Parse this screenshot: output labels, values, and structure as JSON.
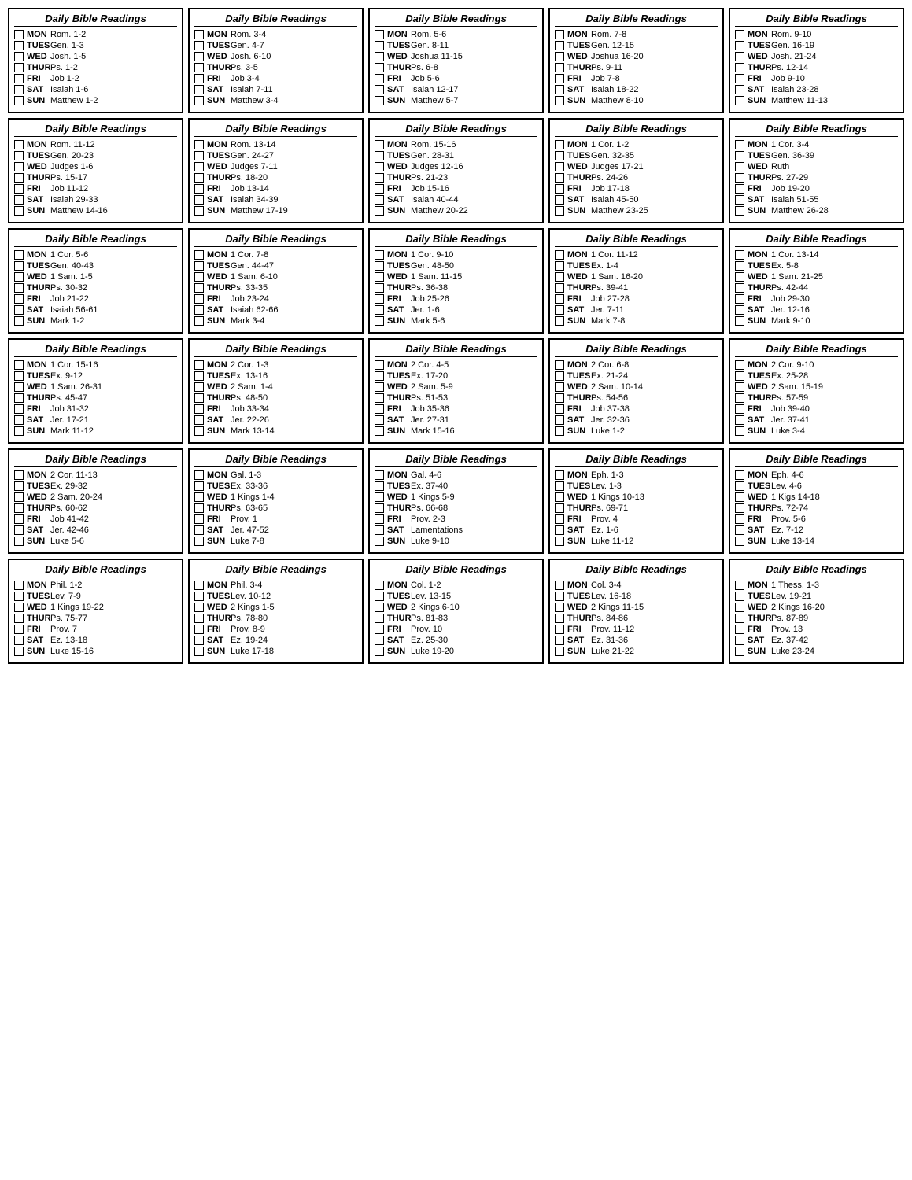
{
  "cards": [
    {
      "title": "Daily Bible Readings",
      "readings": [
        {
          "day": "MON",
          "text": "Rom. 1-2"
        },
        {
          "day": "TUES",
          "text": "Gen. 1-3"
        },
        {
          "day": "WED",
          "text": "Josh. 1-5"
        },
        {
          "day": "THUR",
          "text": "Ps. 1-2"
        },
        {
          "day": "FRI",
          "text": "Job 1-2"
        },
        {
          "day": "SAT",
          "text": "Isaiah 1-6"
        },
        {
          "day": "SUN",
          "text": "Matthew 1-2"
        }
      ]
    },
    {
      "title": "Daily Bible Readings",
      "readings": [
        {
          "day": "MON",
          "text": "Rom. 3-4"
        },
        {
          "day": "TUES",
          "text": "Gen. 4-7"
        },
        {
          "day": "WED",
          "text": "Josh. 6-10"
        },
        {
          "day": "THUR",
          "text": "Ps. 3-5"
        },
        {
          "day": "FRI",
          "text": "Job 3-4"
        },
        {
          "day": "SAT",
          "text": "Isaiah 7-11"
        },
        {
          "day": "SUN",
          "text": "Matthew 3-4"
        }
      ]
    },
    {
      "title": "Daily Bible Readings",
      "readings": [
        {
          "day": "MON",
          "text": "Rom. 5-6"
        },
        {
          "day": "TUES",
          "text": "Gen. 8-11"
        },
        {
          "day": "WED",
          "text": "Joshua 11-15"
        },
        {
          "day": "THUR",
          "text": "Ps. 6-8"
        },
        {
          "day": "FRI",
          "text": "Job 5-6"
        },
        {
          "day": "SAT",
          "text": "Isaiah 12-17"
        },
        {
          "day": "SUN",
          "text": "Matthew 5-7"
        }
      ]
    },
    {
      "title": "Daily Bible Readings",
      "readings": [
        {
          "day": "MON",
          "text": "Rom. 7-8"
        },
        {
          "day": "TUES",
          "text": "Gen. 12-15"
        },
        {
          "day": "WED",
          "text": "Joshua 16-20"
        },
        {
          "day": "THUR",
          "text": "Ps. 9-11"
        },
        {
          "day": "FRI",
          "text": "Job 7-8"
        },
        {
          "day": "SAT",
          "text": "Isaiah 18-22"
        },
        {
          "day": "SUN",
          "text": "Matthew 8-10"
        }
      ]
    },
    {
      "title": "Daily Bible Readings",
      "readings": [
        {
          "day": "MON",
          "text": "Rom. 9-10"
        },
        {
          "day": "TUES",
          "text": "Gen. 16-19"
        },
        {
          "day": "WED",
          "text": "Josh. 21-24"
        },
        {
          "day": "THUR",
          "text": "Ps. 12-14"
        },
        {
          "day": "FRI",
          "text": "Job 9-10"
        },
        {
          "day": "SAT",
          "text": "Isaiah 23-28"
        },
        {
          "day": "SUN",
          "text": "Matthew 11-13"
        }
      ]
    },
    {
      "title": "Daily Bible Readings",
      "readings": [
        {
          "day": "MON",
          "text": "Rom. 11-12"
        },
        {
          "day": "TUES",
          "text": "Gen. 20-23"
        },
        {
          "day": "WED",
          "text": "Judges 1-6"
        },
        {
          "day": "THUR",
          "text": "Ps. 15-17"
        },
        {
          "day": "FRI",
          "text": "Job 11-12"
        },
        {
          "day": "SAT",
          "text": "Isaiah 29-33"
        },
        {
          "day": "SUN",
          "text": "Matthew 14-16"
        }
      ]
    },
    {
      "title": "Daily Bible Readings",
      "readings": [
        {
          "day": "MON",
          "text": "Rom. 13-14"
        },
        {
          "day": "TUES",
          "text": "Gen. 24-27"
        },
        {
          "day": "WED",
          "text": "Judges 7-11"
        },
        {
          "day": "THUR",
          "text": "Ps. 18-20"
        },
        {
          "day": "FRI",
          "text": "Job 13-14"
        },
        {
          "day": "SAT",
          "text": "Isaiah 34-39"
        },
        {
          "day": "SUN",
          "text": "Matthew 17-19"
        }
      ]
    },
    {
      "title": "Daily Bible Readings",
      "readings": [
        {
          "day": "MON",
          "text": "Rom. 15-16"
        },
        {
          "day": "TUES",
          "text": "Gen. 28-31"
        },
        {
          "day": "WED",
          "text": "Judges 12-16"
        },
        {
          "day": "THUR",
          "text": "Ps. 21-23"
        },
        {
          "day": "FRI",
          "text": "Job 15-16"
        },
        {
          "day": "SAT",
          "text": "Isaiah 40-44"
        },
        {
          "day": "SUN",
          "text": "Matthew 20-22"
        }
      ]
    },
    {
      "title": "Daily Bible Readings",
      "readings": [
        {
          "day": "MON",
          "text": "1 Cor. 1-2"
        },
        {
          "day": "TUES",
          "text": "Gen. 32-35"
        },
        {
          "day": "WED",
          "text": "Judges 17-21"
        },
        {
          "day": "THUR",
          "text": "Ps. 24-26"
        },
        {
          "day": "FRI",
          "text": "Job 17-18"
        },
        {
          "day": "SAT",
          "text": "Isaiah 45-50"
        },
        {
          "day": "SUN",
          "text": "Matthew 23-25"
        }
      ]
    },
    {
      "title": "Daily Bible Readings",
      "readings": [
        {
          "day": "MON",
          "text": "1 Cor. 3-4"
        },
        {
          "day": "TUES",
          "text": "Gen. 36-39"
        },
        {
          "day": "WED",
          "text": "Ruth"
        },
        {
          "day": "THUR",
          "text": "Ps. 27-29"
        },
        {
          "day": "FRI",
          "text": "Job 19-20"
        },
        {
          "day": "SAT",
          "text": "Isaiah 51-55"
        },
        {
          "day": "SUN",
          "text": "Matthew 26-28"
        }
      ]
    },
    {
      "title": "Daily Bible Readings",
      "readings": [
        {
          "day": "MON",
          "text": "1 Cor. 5-6"
        },
        {
          "day": "TUES",
          "text": "Gen. 40-43"
        },
        {
          "day": "WED",
          "text": "1 Sam. 1-5"
        },
        {
          "day": "THUR",
          "text": "Ps. 30-32"
        },
        {
          "day": "FRI",
          "text": "Job 21-22"
        },
        {
          "day": "SAT",
          "text": "Isaiah 56-61"
        },
        {
          "day": "SUN",
          "text": "Mark 1-2"
        }
      ]
    },
    {
      "title": "Daily Bible Readings",
      "readings": [
        {
          "day": "MON",
          "text": "1 Cor. 7-8"
        },
        {
          "day": "TUES",
          "text": "Gen. 44-47"
        },
        {
          "day": "WED",
          "text": "1 Sam. 6-10"
        },
        {
          "day": "THUR",
          "text": "Ps. 33-35"
        },
        {
          "day": "FRI",
          "text": "Job 23-24"
        },
        {
          "day": "SAT",
          "text": "Isaiah 62-66"
        },
        {
          "day": "SUN",
          "text": "Mark 3-4"
        }
      ]
    },
    {
      "title": "Daily Bible Readings",
      "readings": [
        {
          "day": "MON",
          "text": "1 Cor. 9-10"
        },
        {
          "day": "TUES",
          "text": "Gen. 48-50"
        },
        {
          "day": "WED",
          "text": "1 Sam. 11-15"
        },
        {
          "day": "THUR",
          "text": "Ps. 36-38"
        },
        {
          "day": "FRI",
          "text": "Job 25-26"
        },
        {
          "day": "SAT",
          "text": "Jer. 1-6"
        },
        {
          "day": "SUN",
          "text": "Mark 5-6"
        }
      ]
    },
    {
      "title": "Daily Bible Readings",
      "readings": [
        {
          "day": "MON",
          "text": "1 Cor. 11-12"
        },
        {
          "day": "TUES",
          "text": "Ex. 1-4"
        },
        {
          "day": "WED",
          "text": "1 Sam. 16-20"
        },
        {
          "day": "THUR",
          "text": "Ps. 39-41"
        },
        {
          "day": "FRI",
          "text": "Job 27-28"
        },
        {
          "day": "SAT",
          "text": "Jer. 7-11"
        },
        {
          "day": "SUN",
          "text": "Mark 7-8"
        }
      ]
    },
    {
      "title": "Daily Bible Readings",
      "readings": [
        {
          "day": "MON",
          "text": "1 Cor. 13-14"
        },
        {
          "day": "TUES",
          "text": "Ex. 5-8"
        },
        {
          "day": "WED",
          "text": "1 Sam. 21-25"
        },
        {
          "day": "THUR",
          "text": "Ps. 42-44"
        },
        {
          "day": "FRI",
          "text": "Job 29-30"
        },
        {
          "day": "SAT",
          "text": "Jer. 12-16"
        },
        {
          "day": "SUN",
          "text": "Mark 9-10"
        }
      ]
    },
    {
      "title": "Daily Bible Readings",
      "readings": [
        {
          "day": "MON",
          "text": "1 Cor. 15-16"
        },
        {
          "day": "TUES",
          "text": "Ex. 9-12"
        },
        {
          "day": "WED",
          "text": "1 Sam. 26-31"
        },
        {
          "day": "THUR",
          "text": "Ps. 45-47"
        },
        {
          "day": "FRI",
          "text": "Job 31-32"
        },
        {
          "day": "SAT",
          "text": "Jer. 17-21"
        },
        {
          "day": "SUN",
          "text": "Mark 11-12"
        }
      ]
    },
    {
      "title": "Daily Bible Readings",
      "readings": [
        {
          "day": "MON",
          "text": "2 Cor. 1-3"
        },
        {
          "day": "TUES",
          "text": "Ex. 13-16"
        },
        {
          "day": "WED",
          "text": "2 Sam. 1-4"
        },
        {
          "day": "THUR",
          "text": "Ps. 48-50"
        },
        {
          "day": "FRI",
          "text": "Job 33-34"
        },
        {
          "day": "SAT",
          "text": "Jer. 22-26"
        },
        {
          "day": "SUN",
          "text": "Mark 13-14"
        }
      ]
    },
    {
      "title": "Daily Bible Readings",
      "readings": [
        {
          "day": "MON",
          "text": "2 Cor. 4-5"
        },
        {
          "day": "TUES",
          "text": "Ex. 17-20"
        },
        {
          "day": "WED",
          "text": "2 Sam. 5-9"
        },
        {
          "day": "THUR",
          "text": "Ps. 51-53"
        },
        {
          "day": "FRI",
          "text": "Job 35-36"
        },
        {
          "day": "SAT",
          "text": "Jer. 27-31"
        },
        {
          "day": "SUN",
          "text": "Mark 15-16"
        }
      ]
    },
    {
      "title": "Daily Bible Readings",
      "readings": [
        {
          "day": "MON",
          "text": "2 Cor. 6-8"
        },
        {
          "day": "TUES",
          "text": "Ex. 21-24"
        },
        {
          "day": "WED",
          "text": "2 Sam. 10-14"
        },
        {
          "day": "THUR",
          "text": "Ps. 54-56"
        },
        {
          "day": "FRI",
          "text": "Job 37-38"
        },
        {
          "day": "SAT",
          "text": "Jer. 32-36"
        },
        {
          "day": "SUN",
          "text": "Luke 1-2"
        }
      ]
    },
    {
      "title": "Daily Bible Readings",
      "readings": [
        {
          "day": "MON",
          "text": "2 Cor. 9-10"
        },
        {
          "day": "TUES",
          "text": "Ex. 25-28"
        },
        {
          "day": "WED",
          "text": "2 Sam. 15-19"
        },
        {
          "day": "THUR",
          "text": "Ps. 57-59"
        },
        {
          "day": "FRI",
          "text": "Job 39-40"
        },
        {
          "day": "SAT",
          "text": "Jer. 37-41"
        },
        {
          "day": "SUN",
          "text": "Luke 3-4"
        }
      ]
    },
    {
      "title": "Daily Bible Readings",
      "readings": [
        {
          "day": "MON",
          "text": "2 Cor. 11-13"
        },
        {
          "day": "TUES",
          "text": "Ex. 29-32"
        },
        {
          "day": "WED",
          "text": "2 Sam. 20-24"
        },
        {
          "day": "THUR",
          "text": "Ps. 60-62"
        },
        {
          "day": "FRI",
          "text": "Job 41-42"
        },
        {
          "day": "SAT",
          "text": "Jer. 42-46"
        },
        {
          "day": "SUN",
          "text": "Luke 5-6"
        }
      ]
    },
    {
      "title": "Daily Bible Readings",
      "readings": [
        {
          "day": "MON",
          "text": "Gal. 1-3"
        },
        {
          "day": "TUES",
          "text": "Ex. 33-36"
        },
        {
          "day": "WED",
          "text": "1 Kings 1-4"
        },
        {
          "day": "THUR",
          "text": "Ps. 63-65"
        },
        {
          "day": "FRI",
          "text": "Prov. 1"
        },
        {
          "day": "SAT",
          "text": "Jer. 47-52"
        },
        {
          "day": "SUN",
          "text": "Luke 7-8"
        }
      ]
    },
    {
      "title": "Daily Bible Readings",
      "readings": [
        {
          "day": "MON",
          "text": "Gal. 4-6"
        },
        {
          "day": "TUES",
          "text": "Ex. 37-40"
        },
        {
          "day": "WED",
          "text": "1 Kings 5-9"
        },
        {
          "day": "THUR",
          "text": "Ps. 66-68"
        },
        {
          "day": "FRI",
          "text": "Prov. 2-3"
        },
        {
          "day": "SAT",
          "text": "Lamentations"
        },
        {
          "day": "SUN",
          "text": "Luke 9-10"
        }
      ]
    },
    {
      "title": "Daily Bible Readings",
      "readings": [
        {
          "day": "MON",
          "text": "Eph. 1-3"
        },
        {
          "day": "TUES",
          "text": "Lev. 1-3"
        },
        {
          "day": "WED",
          "text": "1 Kings 10-13"
        },
        {
          "day": "THUR",
          "text": "Ps. 69-71"
        },
        {
          "day": "FRI",
          "text": "Prov. 4"
        },
        {
          "day": "SAT",
          "text": "Ez. 1-6"
        },
        {
          "day": "SUN",
          "text": "Luke 11-12"
        }
      ]
    },
    {
      "title": "Daily Bible Readings",
      "readings": [
        {
          "day": "MON",
          "text": "Eph. 4-6"
        },
        {
          "day": "TUES",
          "text": "Lev. 4-6"
        },
        {
          "day": "WED",
          "text": "1 Kigs 14-18"
        },
        {
          "day": "THUR",
          "text": "Ps. 72-74"
        },
        {
          "day": "FRI",
          "text": "Prov. 5-6"
        },
        {
          "day": "SAT",
          "text": "Ez. 7-12"
        },
        {
          "day": "SUN",
          "text": "Luke 13-14"
        }
      ]
    },
    {
      "title": "Daily Bible Readings",
      "readings": [
        {
          "day": "MON",
          "text": "Phil. 1-2"
        },
        {
          "day": "TUES",
          "text": "Lev. 7-9"
        },
        {
          "day": "WED",
          "text": "1 Kings 19-22"
        },
        {
          "day": "THUR",
          "text": "Ps. 75-77"
        },
        {
          "day": "FRI",
          "text": "Prov. 7"
        },
        {
          "day": "SAT",
          "text": "Ez. 13-18"
        },
        {
          "day": "SUN",
          "text": "Luke 15-16"
        }
      ]
    },
    {
      "title": "Daily Bible Readings",
      "readings": [
        {
          "day": "MON",
          "text": "Phil. 3-4"
        },
        {
          "day": "TUES",
          "text": "Lev. 10-12"
        },
        {
          "day": "WED",
          "text": "2 Kings 1-5"
        },
        {
          "day": "THUR",
          "text": "Ps. 78-80"
        },
        {
          "day": "FRI",
          "text": "Prov. 8-9"
        },
        {
          "day": "SAT",
          "text": "Ez. 19-24"
        },
        {
          "day": "SUN",
          "text": "Luke 17-18"
        }
      ]
    },
    {
      "title": "Daily Bible Readings",
      "readings": [
        {
          "day": "MON",
          "text": "Col. 1-2"
        },
        {
          "day": "TUES",
          "text": "Lev. 13-15"
        },
        {
          "day": "WED",
          "text": "2 Kings 6-10"
        },
        {
          "day": "THUR",
          "text": "Ps. 81-83"
        },
        {
          "day": "FRI",
          "text": "Prov. 10"
        },
        {
          "day": "SAT",
          "text": "Ez. 25-30"
        },
        {
          "day": "SUN",
          "text": "Luke 19-20"
        }
      ]
    },
    {
      "title": "Daily Bible Readings",
      "readings": [
        {
          "day": "MON",
          "text": "Col. 3-4"
        },
        {
          "day": "TUES",
          "text": "Lev. 16-18"
        },
        {
          "day": "WED",
          "text": "2 Kings 11-15"
        },
        {
          "day": "THUR",
          "text": "Ps. 84-86"
        },
        {
          "day": "FRI",
          "text": "Prov. 11-12"
        },
        {
          "day": "SAT",
          "text": "Ez. 31-36"
        },
        {
          "day": "SUN",
          "text": "Luke 21-22"
        }
      ]
    },
    {
      "title": "Daily Bible Readings",
      "readings": [
        {
          "day": "MON",
          "text": "1 Thess. 1-3"
        },
        {
          "day": "TUES",
          "text": "Lev. 19-21"
        },
        {
          "day": "WED",
          "text": "2 Kings 16-20"
        },
        {
          "day": "THUR",
          "text": "Ps. 87-89"
        },
        {
          "day": "FRI",
          "text": "Prov. 13"
        },
        {
          "day": "SAT",
          "text": "Ez. 37-42"
        },
        {
          "day": "SUN",
          "text": "Luke 23-24"
        }
      ]
    }
  ]
}
